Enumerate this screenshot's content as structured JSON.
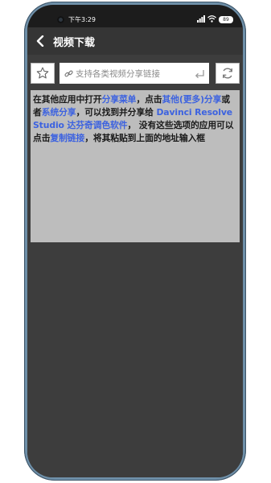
{
  "status_bar": {
    "time": "下午3:29",
    "battery": "89"
  },
  "appbar": {
    "title": "视频下载"
  },
  "url_row": {
    "placeholder": "支持各类视频分享链接"
  },
  "instructions": {
    "segments": [
      {
        "text": "在其他应用中打开",
        "style": "plain"
      },
      {
        "text": "分享菜单",
        "style": "hl"
      },
      {
        "text": "，点击",
        "style": "plain"
      },
      {
        "text": "其他(更多)分享",
        "style": "hl"
      },
      {
        "text": "或者",
        "style": "plain"
      },
      {
        "text": "系统分享",
        "style": "hl"
      },
      {
        "text": "，可以找到并分享给 ",
        "style": "plain"
      },
      {
        "text": "Davinci Resolve Studio 达芬奇调色软件",
        "style": "appname"
      },
      {
        "text": "， 没有这些选项的应用可以点击",
        "style": "plain"
      },
      {
        "text": "复制链接",
        "style": "hl"
      },
      {
        "text": "，将其粘贴到上面的地址输入框",
        "style": "plain"
      }
    ]
  },
  "colors": {
    "accent": "#3c62e0",
    "appbar": "#353535",
    "background": "#3d3d3d",
    "info_box": "#bdbdbd"
  },
  "icons": {
    "back": "back-arrow-icon",
    "favorite": "star-icon",
    "link": "link-icon",
    "enter": "enter-icon",
    "refresh": "refresh-icon"
  }
}
